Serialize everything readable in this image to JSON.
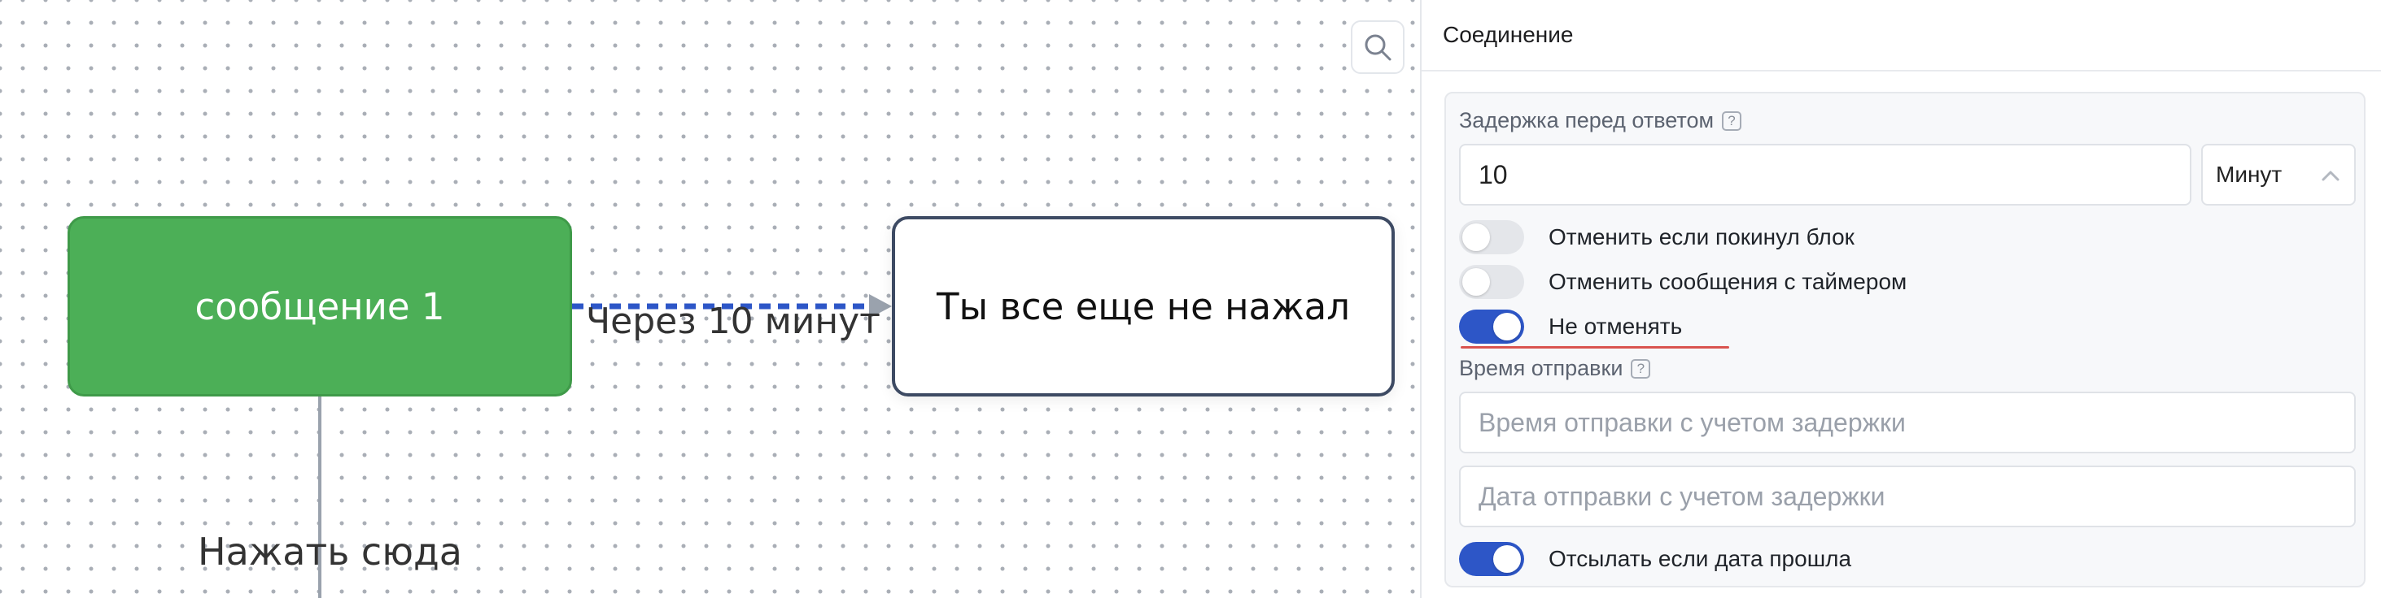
{
  "canvas": {
    "nodes": {
      "message": {
        "label": "сообщение 1",
        "color": "#4caf57"
      },
      "reminder": {
        "label": "Ты все еще не нажал"
      }
    },
    "edge_label": "Через 10 минут",
    "button_label": "Нажать сюда",
    "zoom_icon": "search-icon",
    "connector_color": "#2d56c7"
  },
  "panel": {
    "title": "Соединение",
    "delay": {
      "label": "Задержка перед ответом",
      "help": "?",
      "value": "10",
      "unit": "Минут",
      "unit_icon": "chevron-up-icon"
    },
    "toggles": [
      {
        "label": "Отменить если покинул блок",
        "on": false
      },
      {
        "label": "Отменить сообщения с таймером",
        "on": false
      },
      {
        "label": "Не отменять",
        "on": true
      }
    ],
    "send_time": {
      "label": "Время отправки",
      "help": "?",
      "time_placeholder": "Время отправки с учетом задержки",
      "date_placeholder": "Дата отправки с учетом задержки"
    },
    "send_if_past": {
      "label": "Отсылать если дата прошла",
      "on": true
    },
    "accent_color": "#2d56c7",
    "highlight_color": "#d9534f"
  }
}
